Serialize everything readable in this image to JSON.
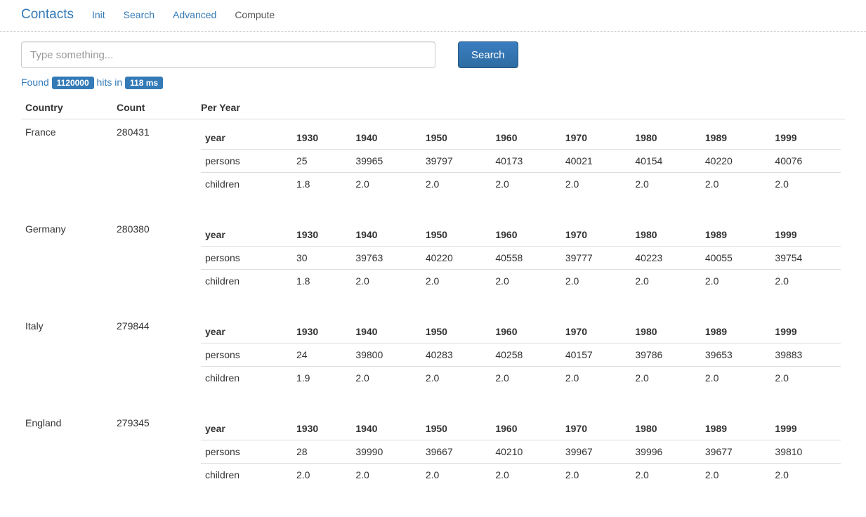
{
  "navbar": {
    "brand": "Contacts",
    "items": [
      {
        "label": "Init"
      },
      {
        "label": "Search"
      },
      {
        "label": "Advanced"
      },
      {
        "label": "Compute",
        "active": true
      }
    ]
  },
  "search": {
    "placeholder": "Type something...",
    "value": "",
    "button_label": "Search"
  },
  "results_summary": {
    "prefix": "Found",
    "hits": "1120000",
    "middle": "hits in",
    "time": "118 ms"
  },
  "main_table": {
    "headers": {
      "country": "Country",
      "count": "Count",
      "per_year": "Per Year"
    },
    "inner_labels": {
      "year": "year",
      "persons": "persons",
      "children": "children"
    },
    "rows": [
      {
        "country": "France",
        "count": "280431",
        "years": [
          "1930",
          "1940",
          "1950",
          "1960",
          "1970",
          "1980",
          "1989",
          "1999"
        ],
        "persons": [
          "25",
          "39965",
          "39797",
          "40173",
          "40021",
          "40154",
          "40220",
          "40076"
        ],
        "children": [
          "1.8",
          "2.0",
          "2.0",
          "2.0",
          "2.0",
          "2.0",
          "2.0",
          "2.0"
        ]
      },
      {
        "country": "Germany",
        "count": "280380",
        "years": [
          "1930",
          "1940",
          "1950",
          "1960",
          "1970",
          "1980",
          "1989",
          "1999"
        ],
        "persons": [
          "30",
          "39763",
          "40220",
          "40558",
          "39777",
          "40223",
          "40055",
          "39754"
        ],
        "children": [
          "1.8",
          "2.0",
          "2.0",
          "2.0",
          "2.0",
          "2.0",
          "2.0",
          "2.0"
        ]
      },
      {
        "country": "Italy",
        "count": "279844",
        "years": [
          "1930",
          "1940",
          "1950",
          "1960",
          "1970",
          "1980",
          "1989",
          "1999"
        ],
        "persons": [
          "24",
          "39800",
          "40283",
          "40258",
          "40157",
          "39786",
          "39653",
          "39883"
        ],
        "children": [
          "1.9",
          "2.0",
          "2.0",
          "2.0",
          "2.0",
          "2.0",
          "2.0",
          "2.0"
        ]
      },
      {
        "country": "England",
        "count": "279345",
        "years": [
          "1930",
          "1940",
          "1950",
          "1960",
          "1970",
          "1980",
          "1989",
          "1999"
        ],
        "persons": [
          "28",
          "39990",
          "39667",
          "40210",
          "39967",
          "39996",
          "39677",
          "39810"
        ],
        "children": [
          "2.0",
          "2.0",
          "2.0",
          "2.0",
          "2.0",
          "2.0",
          "2.0",
          "2.0"
        ]
      }
    ]
  }
}
